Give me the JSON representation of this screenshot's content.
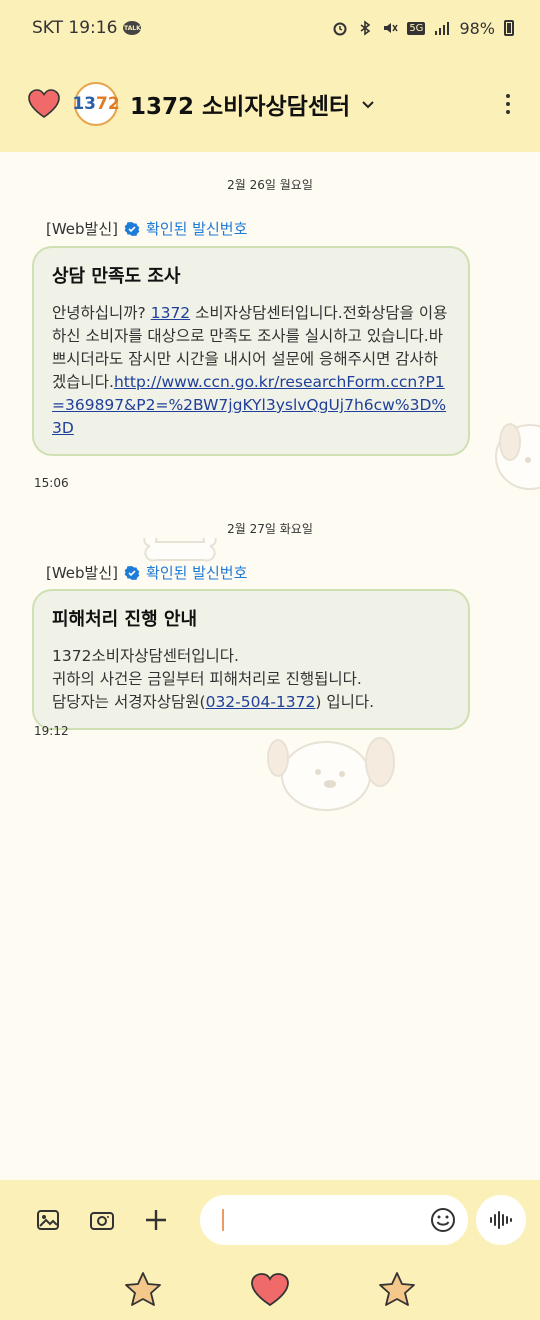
{
  "status_bar": {
    "carrier_time": "SKT 19:16",
    "talk_badge": "TALK",
    "network": "5G",
    "battery": "98%"
  },
  "header": {
    "logo_text_a": "13",
    "logo_text_b": "72",
    "title": "1372 소비자상담센터"
  },
  "messages": [
    {
      "date": "2월 26일 월요일",
      "sender_label": "[Web발신]",
      "verified_label": "확인된 발신번호",
      "title": "상담 만족도 조사",
      "body_pre": "안녕하십니까? ",
      "body_link1": "1372",
      "body_mid": "소비자상담센터입니다.전화상담을 이용하신 소비자를 대상으로 만족도 조사를 실시하고 있습니다.바쁘시더라도 잠시만 시간을 내시어 설문에 응해주시면 감사하겠습니다.",
      "body_link2": "http://www.ccn.go.kr/researchForm.ccn?P1=369897&P2=%2BW7jgKYl3yslvQgUj7h6cw%3D%3D",
      "time": "15:06"
    },
    {
      "date": "2월 27일 화요일",
      "sender_label": "[Web발신]",
      "verified_label": "확인된 발신번호",
      "title": "피해처리 진행 안내",
      "line1": "1372소비자상담센터입니다.",
      "line2": "귀하의 사건은 금일부터 피해처리로 진행됩니다.",
      "line3_pre": "담당자는 서경자상담원(",
      "line3_link": "032-504-1372",
      "line3_post": ") 입니다.",
      "time": "19:12"
    }
  ],
  "input": {
    "placeholder": ""
  },
  "colors": {
    "header_bg": "#fcf0b9",
    "bubble_bg": "#f1f2e7",
    "bubble_border": "#cfe0b3",
    "verified": "#1e7bd8",
    "link": "#1f3f9a",
    "heart": "#f06a6a",
    "star": "#f4c78a"
  }
}
